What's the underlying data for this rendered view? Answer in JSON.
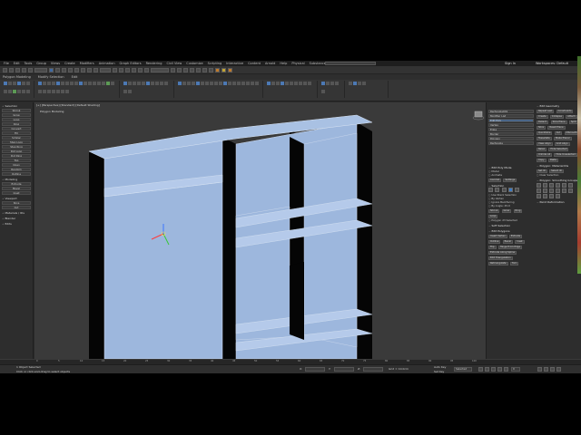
{
  "window": {
    "menu": [
      "File",
      "Edit",
      "Tools",
      "Group",
      "Views",
      "Create",
      "Modifiers",
      "Animation",
      "Graph Editors",
      "Rendering",
      "Civil View",
      "Customize",
      "Scripting",
      "Interactive",
      "Content",
      "Arnold",
      "Help",
      "Physical",
      "Substance",
      "Exchange Store",
      "Stair Plus"
    ],
    "search_placeholder": "Type a keyword or phrase",
    "sign_in": "Sign In",
    "workspaces": "Workspaces: Default"
  },
  "toolbar": {
    "selection_filter": "All",
    "named_sets": "Create Selection Set",
    "view_dropdown": "View"
  },
  "ribbon": {
    "groups": [
      "Polygon Modeling",
      "Modify Selection",
      "Edit",
      "Geometry (All)",
      "Subdivision",
      "Align",
      "Properties"
    ]
  },
  "viewport": {
    "label": "[+] [Perspective] [Standard] [Default Shading]",
    "tab": "Polygon Modeling"
  },
  "left_panel": {
    "sections": [
      {
        "title": "Selection",
        "items": [
          "Shrink",
          "Grow",
          "Loop",
          "Ring",
          "Convert",
          "Fill",
          "Similar",
          "Step Loop",
          "Step Ring",
          "Dot Loop",
          "Dot Ring",
          "Top",
          "Open",
          "Random",
          "Outline"
        ]
      },
      {
        "title": "Modeling",
        "items": [
          "Extrude",
          "Bevel",
          "Inset"
        ]
      },
      {
        "title": "Viewport",
        "items": [
          "Slice",
          "Cut"
        ]
      },
      {
        "title": "Materials / IDs",
        "items": []
      },
      {
        "title": "Blender",
        "items": []
      },
      {
        "title": "Edits",
        "items": []
      }
    ]
  },
  "right_panel": {
    "object_name": "Rectangle001",
    "modifier_list": "Modifier List",
    "stack": [
      "Edit Poly",
      "Vertex",
      "Edge",
      "Border",
      "Polygon",
      "Element",
      "Rectangle"
    ],
    "edit_poly_mode": {
      "title": "Edit Poly Mode",
      "options": [
        "Model",
        "Animate"
      ],
      "buttons": [
        "Commit",
        "Settings",
        "Cancel"
      ]
    },
    "selection": {
      "title": "Selection",
      "options": [
        "Use Stack Selection",
        "By Vertex",
        "Ignore Backfacing",
        "By Angle: 45.0",
        "Shrink",
        "Grow",
        "Ring",
        "Loop"
      ],
      "status": "Polygon 23 Selected"
    },
    "soft_selection": "Soft Selection",
    "edit_polygons": {
      "title": "Edit Polygons",
      "buttons": [
        "Insert Vertex",
        "Extrude",
        "Outline",
        "Bevel",
        "Inset",
        "Flip",
        "Hinge From Edge",
        "Extrude Along Spline",
        "Edit Triangulation",
        "Retriangulate",
        "Turn"
      ]
    },
    "edit_geometry": {
      "title": "Edit Geometry",
      "buttons": [
        "Repeat Last",
        "Constraints",
        "Create",
        "Collapse",
        "Attach",
        "Detach",
        "Slice Plane",
        "Split",
        "Slice",
        "Reset Plane",
        "QuickSlice",
        "Cut",
        "MSmooth",
        "Tessellate",
        "Make Planar",
        "View Align",
        "Grid Align",
        "Relax",
        "Hide Selected",
        "Unhide All",
        "Hide Unselected",
        "Copy",
        "Paste"
      ]
    },
    "material_ids": {
      "title": "Polygon: Material IDs",
      "set_id": "Set ID",
      "select_id": "Select ID",
      "clear_selection": "Clear Selection"
    },
    "smoothing_groups": "Polygon: Smoothing Groups",
    "paint_deformation": "Paint Deformation"
  },
  "timeline": {
    "ticks": [
      "0",
      "5",
      "10",
      "15",
      "20",
      "25",
      "30",
      "35",
      "40",
      "45",
      "50",
      "55",
      "60",
      "65",
      "70",
      "75",
      "80",
      "85",
      "90",
      "95",
      "100"
    ]
  },
  "status": {
    "selection": "1 Object Selected",
    "prompt": "Click or click-and-drag to select objects",
    "x": "X:",
    "y": "Y:",
    "z": "Z:",
    "grid": "Grid = 10.0cm",
    "auto_key": "Auto Key",
    "selected": "Selected",
    "set_key": "Set Key",
    "key_filters": "Key Filters...",
    "frame": "0"
  },
  "colors": {
    "object": "#9db7dd",
    "viewport_bg": "#3a3a3a",
    "accent": "#3e7cc4"
  }
}
